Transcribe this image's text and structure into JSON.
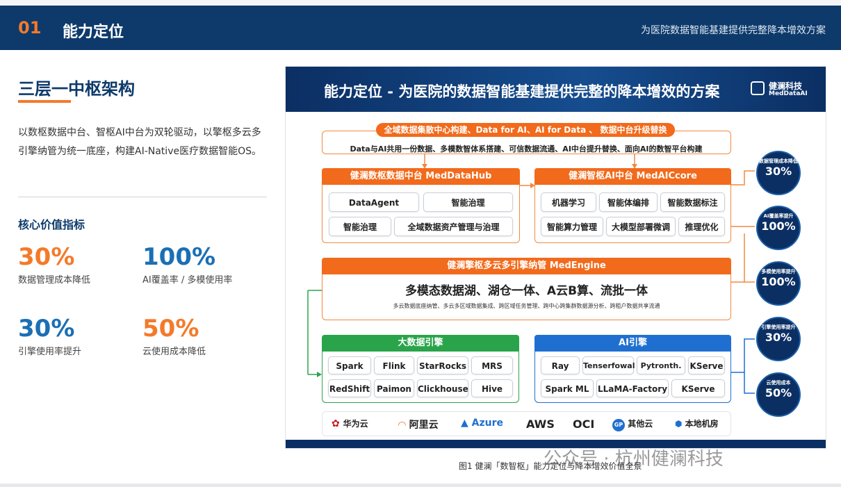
{
  "header": {
    "number": "01",
    "title": "能力定位",
    "subtitle": "为医院数据智能基建提供完整降本增效方案"
  },
  "left": {
    "title": "三层一中枢架构",
    "description": "以数枢数据中台、智枢AI中台为双轮驱动，以擎枢多云多引擎纳管为统一底座，构建AI-Native医疗数据智能OS。",
    "kpi_heading": "核心价值指标",
    "kpis": [
      {
        "value": "30%",
        "label": "数据管理成本降低"
      },
      {
        "value": "100%",
        "label": "AI覆盖率 / 多模使用率"
      },
      {
        "value": "30%",
        "label": "引擎使用率提升"
      },
      {
        "value": "50%",
        "label": "云使用成本降低"
      }
    ]
  },
  "figure": {
    "title": "能力定位 - 为医院的数据智能基建提供完整的降本增效的方案",
    "logo_cn": "健澜科技",
    "logo_en": "MedDataAI",
    "top": {
      "pill": "全域数据集散中心构建、Data for AI、AI for Data 、 数据中台升级替换",
      "line": "Data与AI共用一份数据、多模数智体系搭建、可信数据流通、AI中台提升替换、面向AI的数智平台构建"
    },
    "meddatahub": {
      "caption": "健澜数枢数据中台 MedDataHub",
      "chips": [
        "DataAgent",
        "智能治理",
        "智能治理",
        "全域数据资产管理与治理"
      ]
    },
    "medaicore": {
      "caption": "健澜智枢AI中台 MedAICcore",
      "chips": [
        "机器学习",
        "智能体编排",
        "智能数据标注",
        "智能算力管理",
        "大模型部署微调",
        "推理优化"
      ]
    },
    "medengine": {
      "caption": "健澜擎枢多云多引擎纳管 MedEngine",
      "headline": "多模态数据湖、湖仓一体、A云B算、流批一体",
      "line": "多云数据底座纳管、多云多区域数据集成、跨区域任务管理、跨中心跨集群数据源分析、跨租户数据共享流通"
    },
    "bigdata": {
      "caption": "大数据引擎",
      "chips": [
        "Spark",
        "Flink",
        "StarRocks",
        "MRS",
        "RedShift",
        "Paimon",
        "Clickhouse",
        "Hive"
      ]
    },
    "ai_engine": {
      "caption": "AI引擎",
      "chips": [
        "Ray",
        "Tenserfowal",
        "Pytronth.",
        "KServe",
        "Spark ML",
        "LLaMA-Factory",
        "KServe"
      ]
    },
    "clouds": [
      "华为云",
      "阿里云",
      "Azure",
      "AWS",
      "OCI",
      "其他云",
      "本地机房"
    ],
    "circles": [
      {
        "label": "数据管理成本降低",
        "value": "30%"
      },
      {
        "label": "AI覆盖率提升",
        "value": "100%"
      },
      {
        "label": "多模使用率提升",
        "value": "100%"
      },
      {
        "label": "引擎使用率提升",
        "value": "30%"
      },
      {
        "label": "云使用成本",
        "value": "50%"
      }
    ]
  },
  "caption": "图1 健澜「数智枢」能力定位与降本增效价值全景",
  "watermark": "公众号 · 杭州健澜科技",
  "colors": {
    "navy": "#0d3a6b",
    "orange": "#f47a2a",
    "blue": "#1b6fb5",
    "green": "#2aa44a",
    "engine_blue": "#1f6fd0"
  }
}
